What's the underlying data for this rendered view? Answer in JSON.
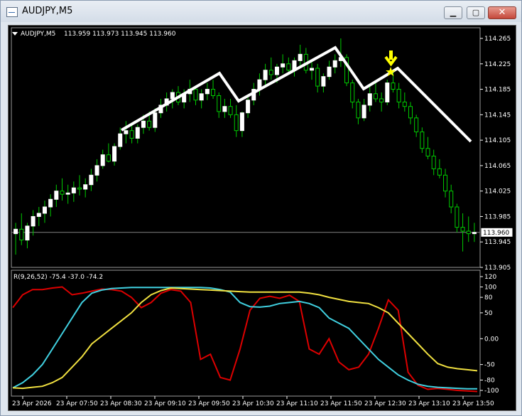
{
  "window": {
    "title": "AUDJPY,M5",
    "minimize_glyph": "▁",
    "maximize_glyph": "▢",
    "close_glyph": "✕"
  },
  "chart_data": [
    {
      "type": "candlestick",
      "symbol_label": "AUDJPY,M5",
      "ohlc_header": "113.959 113.973 113.945 113.960",
      "ylim": [
        113.905,
        114.28
      ],
      "y_ticks": [
        "114.265",
        "114.225",
        "114.185",
        "114.145",
        "114.105",
        "114.065",
        "114.025",
        "113.985",
        "113.945",
        "113.905"
      ],
      "current_price": "113.960",
      "colors": {
        "bull_fill": "#ffffff",
        "wick": "#00cc00",
        "bear_fill": "#000000",
        "bear_outline": "#00cc00",
        "trend_lines": "#ffffff",
        "marker": "#ffff00",
        "price_line": "#808080"
      },
      "candles": [
        [
          113.958,
          113.975,
          113.925,
          113.965
        ],
        [
          113.965,
          113.99,
          113.94,
          113.948
        ],
        [
          113.948,
          113.975,
          113.935,
          113.97
        ],
        [
          113.97,
          113.995,
          113.955,
          113.985
        ],
        [
          113.985,
          114.0,
          113.97,
          113.99
        ],
        [
          113.99,
          114.01,
          113.975,
          114.0
        ],
        [
          114.0,
          114.02,
          113.985,
          114.012
        ],
        [
          114.012,
          114.035,
          114.0,
          114.025
        ],
        [
          114.025,
          114.045,
          114.01,
          114.02
        ],
        [
          114.02,
          114.035,
          114.005,
          114.022
        ],
        [
          114.022,
          114.04,
          114.008,
          114.03
        ],
        [
          114.03,
          114.05,
          114.018,
          114.028
        ],
        [
          114.028,
          114.045,
          114.015,
          114.035
        ],
        [
          114.035,
          114.06,
          114.025,
          114.05
        ],
        [
          114.05,
          114.075,
          114.04,
          114.065
        ],
        [
          114.065,
          114.09,
          114.06,
          114.082
        ],
        [
          114.082,
          114.1,
          114.07,
          114.072
        ],
        [
          114.072,
          114.1,
          114.065,
          114.095
        ],
        [
          114.095,
          114.125,
          114.09,
          114.115
        ],
        [
          114.115,
          114.135,
          114.1,
          114.12
        ],
        [
          114.12,
          114.13,
          114.1,
          114.108
        ],
        [
          114.108,
          114.13,
          114.1,
          114.125
        ],
        [
          114.125,
          114.145,
          114.115,
          114.135
        ],
        [
          114.135,
          114.15,
          114.12,
          114.125
        ],
        [
          114.125,
          114.155,
          114.118,
          114.148
        ],
        [
          114.148,
          114.17,
          114.14,
          114.16
        ],
        [
          114.16,
          114.18,
          114.15,
          114.17
        ],
        [
          114.17,
          114.185,
          114.155,
          114.18
        ],
        [
          114.18,
          114.19,
          114.16,
          114.165
        ],
        [
          114.165,
          114.185,
          114.155,
          114.178
        ],
        [
          114.178,
          114.2,
          114.165,
          114.185
        ],
        [
          114.185,
          114.19,
          114.16,
          114.168
        ],
        [
          114.168,
          114.185,
          114.155,
          114.178
        ],
        [
          114.178,
          114.195,
          114.168,
          114.185
        ],
        [
          114.185,
          114.2,
          114.17,
          114.175
        ],
        [
          114.175,
          114.18,
          114.14,
          114.15
        ],
        [
          114.15,
          114.17,
          114.14,
          114.158
        ],
        [
          114.158,
          114.17,
          114.14,
          114.145
        ],
        [
          114.145,
          114.16,
          114.11,
          114.12
        ],
        [
          114.12,
          114.15,
          114.11,
          114.148
        ],
        [
          114.148,
          114.175,
          114.14,
          114.168
        ],
        [
          114.168,
          114.195,
          114.16,
          114.185
        ],
        [
          114.185,
          114.21,
          114.175,
          114.2
        ],
        [
          114.2,
          114.225,
          114.19,
          114.215
        ],
        [
          114.215,
          114.235,
          114.2,
          114.208
        ],
        [
          114.208,
          114.225,
          114.195,
          114.22
        ],
        [
          114.22,
          114.24,
          114.21,
          114.225
        ],
        [
          114.225,
          114.235,
          114.21,
          114.215
        ],
        [
          114.215,
          114.235,
          114.205,
          114.23
        ],
        [
          114.23,
          114.255,
          114.22,
          114.24
        ],
        [
          114.24,
          114.25,
          114.21,
          114.215
        ],
        [
          114.215,
          114.23,
          114.2,
          114.218
        ],
        [
          114.218,
          114.225,
          114.18,
          114.19
        ],
        [
          114.19,
          114.21,
          114.18,
          114.205
        ],
        [
          114.205,
          114.23,
          114.2,
          114.22
        ],
        [
          114.22,
          114.24,
          114.21,
          114.23
        ],
        [
          114.23,
          114.265,
          114.22,
          114.235
        ],
        [
          114.235,
          114.24,
          114.19,
          114.195
        ],
        [
          114.195,
          114.2,
          114.155,
          114.165
        ],
        [
          114.165,
          114.17,
          114.13,
          114.14
        ],
        [
          114.14,
          114.17,
          114.135,
          114.16
        ],
        [
          114.16,
          114.19,
          114.15,
          114.178
        ],
        [
          114.178,
          114.195,
          114.165,
          114.17
        ],
        [
          114.17,
          114.18,
          114.15,
          114.165
        ],
        [
          114.165,
          114.2,
          114.16,
          114.195
        ],
        [
          114.195,
          114.215,
          114.18,
          114.185
        ],
        [
          114.185,
          114.195,
          114.155,
          114.165
        ],
        [
          114.165,
          114.18,
          114.15,
          114.158
        ],
        [
          114.158,
          114.165,
          114.13,
          114.14
        ],
        [
          114.14,
          114.145,
          114.11,
          114.118
        ],
        [
          114.118,
          114.125,
          114.085,
          114.092
        ],
        [
          114.092,
          114.11,
          114.075,
          114.08
        ],
        [
          114.08,
          114.09,
          114.05,
          114.06
        ],
        [
          114.06,
          114.075,
          114.045,
          114.05
        ],
        [
          114.05,
          114.06,
          114.015,
          114.025
        ],
        [
          114.025,
          114.035,
          113.99,
          114.0
        ],
        [
          114.0,
          114.005,
          113.96,
          113.968
        ],
        [
          113.968,
          113.99,
          113.93,
          113.962
        ],
        [
          113.962,
          113.985,
          113.945,
          113.958
        ],
        [
          113.958,
          113.975,
          113.945,
          113.96
        ]
      ],
      "trend_line_points": [
        [
          159,
          147
        ],
        [
          297,
          67
        ],
        [
          324,
          106
        ],
        [
          460,
          31
        ],
        [
          500,
          89
        ],
        [
          548,
          60
        ],
        [
          651,
          163
        ]
      ],
      "marker_star": "★",
      "marker_arrow": "🡇"
    },
    {
      "type": "line",
      "indicator_label": "R(9,26,52) -75.4 -37.0 -74.2",
      "ylim": [
        -105,
        120
      ],
      "y_ticks": [
        "120",
        "100",
        "80",
        "50",
        "0.00",
        "-50",
        "-80",
        "-100"
      ],
      "series": [
        {
          "color": "#dd0000",
          "values": [
            60,
            85,
            95,
            95,
            98,
            100,
            85,
            88,
            92,
            96,
            95,
            92,
            80,
            60,
            70,
            88,
            95,
            92,
            70,
            -40,
            -30,
            -75,
            -80,
            -20,
            55,
            78,
            82,
            78,
            84,
            72,
            -20,
            -30,
            0,
            -45,
            -60,
            -55,
            -30,
            20,
            75,
            55,
            -65,
            -90,
            -98,
            -96,
            -98,
            -100,
            -101,
            -102
          ]
        },
        {
          "color": "#40d0e0",
          "values": [
            -95,
            -85,
            -70,
            -50,
            -20,
            10,
            40,
            70,
            88,
            94,
            97,
            98,
            99,
            99,
            99,
            99,
            99,
            99,
            99,
            99,
            98,
            95,
            90,
            70,
            62,
            61,
            63,
            68,
            70,
            72,
            68,
            60,
            40,
            30,
            20,
            0,
            -20,
            -40,
            -55,
            -70,
            -80,
            -88,
            -92,
            -94,
            -95,
            -96,
            -97,
            -97
          ]
        },
        {
          "color": "#f0e040",
          "values": [
            -95,
            -96,
            -94,
            -92,
            -85,
            -75,
            -55,
            -35,
            -10,
            5,
            20,
            35,
            50,
            70,
            85,
            93,
            98,
            97,
            96,
            95,
            94,
            93,
            92,
            91,
            90,
            90,
            90,
            90,
            90,
            90,
            88,
            85,
            80,
            76,
            72,
            70,
            68,
            60,
            50,
            30,
            10,
            -10,
            -30,
            -48,
            -55,
            -58,
            -60,
            -62
          ]
        }
      ],
      "x_labels": [
        "23 Apr 2026",
        "23 Apr 07:50",
        "23 Apr 08:30",
        "23 Apr 09:10",
        "23 Apr 09:50",
        "23 Apr 10:30",
        "23 Apr 11:10",
        "23 Apr 11:50",
        "23 Apr 12:30",
        "23 Apr 13:10",
        "23 Apr 13:50"
      ]
    }
  ]
}
